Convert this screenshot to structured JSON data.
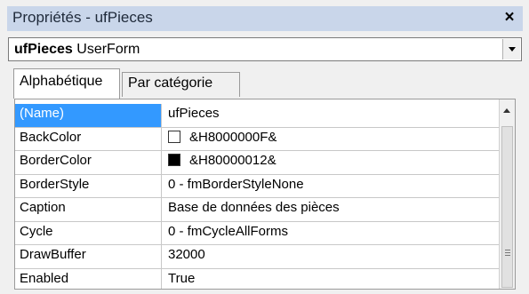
{
  "window": {
    "title": "Propriétés - ufPieces",
    "close_symbol": "×"
  },
  "object_selector": {
    "object_name": "ufPieces",
    "object_type": "UserForm"
  },
  "tabs": [
    {
      "label": "Alphabétique",
      "active": true
    },
    {
      "label": "Par catégorie",
      "active": false
    }
  ],
  "properties": [
    {
      "name": "(Name)",
      "value": "ufPieces",
      "selected": true
    },
    {
      "name": "BackColor",
      "value": "&H8000000F&",
      "swatch": "#ffffff"
    },
    {
      "name": "BorderColor",
      "value": "&H80000012&",
      "swatch": "#000000"
    },
    {
      "name": "BorderStyle",
      "value": "0 - fmBorderStyleNone"
    },
    {
      "name": "Caption",
      "value": "Base de données des pièces"
    },
    {
      "name": "Cycle",
      "value": "0 - fmCycleAllForms"
    },
    {
      "name": "DrawBuffer",
      "value": "32000"
    },
    {
      "name": "Enabled",
      "value": "True"
    }
  ],
  "colors": {
    "title_bar": "#c9d6ea",
    "selection": "#3399ff",
    "window_bg": "#f0f0f0"
  }
}
